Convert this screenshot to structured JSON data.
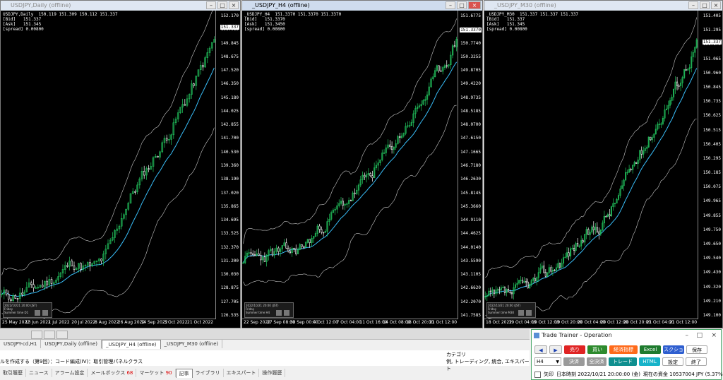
{
  "windows": [
    {
      "title": "USDJPY,Daily (offline)",
      "active": false,
      "info": [
        "USDJPY,Daily  150.119 151.309 150.112 151.337",
        "[Bid]   151.337",
        "[Ask]   151.345",
        "[spread] 0.00800"
      ],
      "price_labels": [
        "152.170",
        "151.015",
        "149.845",
        "148.675",
        "147.520",
        "146.350",
        "145.180",
        "144.025",
        "142.855",
        "141.700",
        "140.530",
        "139.360",
        "138.190",
        "137.020",
        "135.865",
        "134.695",
        "133.525",
        "132.370",
        "131.200",
        "130.030",
        "128.875",
        "127.705",
        "126.535"
      ],
      "current_price": "151.337",
      "time_labels": [
        "25 May 2022",
        "13 Jun 2022",
        "1 Jul 2022",
        "20 Jul 2022",
        "8 Aug 2022",
        "26 Aug 2022",
        "14 Sep 2022",
        "3 Oct 2022",
        "21 Oct 2022"
      ],
      "mini_box": [
        "2022/10/21 20:00 (JST)",
        "Friday",
        "Summer time   D1"
      ]
    },
    {
      "title": "_USDJPY_H4 (offline)",
      "active": true,
      "info": [
        "_USDJPY_H4  151.3370 151.3370 151.3370",
        "[Bid]   151.3370",
        "[Ask]   151.3450",
        "[spread] 0.00800"
      ],
      "price_labels": [
        "151.6775",
        "151.2225",
        "150.7740",
        "150.3255",
        "149.8705",
        "149.4220",
        "148.9735",
        "148.5185",
        "148.0700",
        "147.6150",
        "147.1665",
        "146.7180",
        "146.2630",
        "145.8145",
        "145.3660",
        "144.9110",
        "144.4625",
        "144.0140",
        "143.5590",
        "143.1105",
        "142.6620",
        "142.2070",
        "141.7585"
      ],
      "current_price": "151.3370",
      "time_labels": [
        "22 Sep 2022",
        "27 Sep 08:00",
        "30 Sep 00:00",
        "4 Oct 12:00",
        "7 Oct 04:00",
        "11 Oct 16:00",
        "14 Oct 08:00",
        "18 Oct 20:00",
        "21 Oct 12:00"
      ],
      "mini_box": [
        "2022/10/21 20:00 (JST)",
        "Friday",
        "Summer time   H4"
      ]
    },
    {
      "title": "_USDJPY_M30 (offline)",
      "active": false,
      "info": [
        "_USDJPY_M30  151.337 151.337 151.337",
        "[Bid]   151.337",
        "[Ask]   151.345",
        "[spread] 0.00800"
      ],
      "price_labels": [
        "151.405",
        "151.295",
        "151.175",
        "151.065",
        "150.960",
        "150.845",
        "150.735",
        "150.625",
        "150.515",
        "150.405",
        "150.295",
        "150.185",
        "150.075",
        "149.965",
        "149.855",
        "149.750",
        "149.650",
        "149.540",
        "149.430",
        "149.320",
        "149.210",
        "149.100"
      ],
      "current_price": "151.337",
      "time_labels": [
        "18 Oct 2022",
        "19 Oct 04:00",
        "19 Oct 12:00",
        "19 Oct 20:00",
        "20 Oct 04:00",
        "20 Oct 12:00",
        "20 Oct 20:00",
        "21 Oct 04:00",
        "21 Oct 12:00"
      ],
      "mini_box": [
        "2022/10/21 20:00 (JST)",
        "Friday",
        "Summer time   M30"
      ]
    }
  ],
  "chart_tabs": [
    "USDJPY-cd,H1",
    "USDJPY,Daily (offline)",
    "_USDJPY_H4 (offline)",
    "_USDJPY_M30 (offline)"
  ],
  "news": {
    "text": "ルを作成する（第9回）：コード編成(IV)：取引管理パネルクラス",
    "category_header": "カテゴリ",
    "category_value": "例, トレーディング, 統合, エキスパート"
  },
  "bottom_tabs": [
    {
      "label": "取引履歴",
      "count": ""
    },
    {
      "label": "ニュース",
      "count": ""
    },
    {
      "label": "アラーム設定",
      "count": ""
    },
    {
      "label": "メールボックス",
      "count": "68"
    },
    {
      "label": "マーケット",
      "count": "90"
    },
    {
      "label": "記事",
      "count": ""
    },
    {
      "label": "ライブラリ",
      "count": ""
    },
    {
      "label": "エキスパート",
      "count": ""
    },
    {
      "label": "操作履歴",
      "count": ""
    }
  ],
  "operation": {
    "title": "Trade Trainer - Operation",
    "prev": "◀",
    "next": "▶",
    "timeframe": "H4",
    "sell": "売り",
    "buy": "買い",
    "indicators": "経済指標",
    "excel": "Excel",
    "screenshot": "スクショ",
    "save": "保存",
    "settle": "決済",
    "settle_all": "全決済",
    "trade": "トレード",
    "html": "HTML",
    "settings": "設定",
    "exit": "終了",
    "status_checkbox": "矢印",
    "status_time": "日本時刻 2022/10/21 20:00:00 (金)",
    "status_balance": "現在の資金 10537004 JPY (5.37%)"
  },
  "colors": {
    "bull": "#22c55e",
    "bear": "#ffffff",
    "ma": "#38bdf8",
    "band": "#c8c8c8",
    "sell_btn": "#e02424",
    "buy_btn": "#2e8b2e",
    "indicator_btn": "#ff6a1a",
    "excel_btn": "#1e7b2e",
    "screenshot_btn": "#2f5fd0",
    "trade_btn": "#0f8f8f",
    "html_btn": "#17b3c9"
  }
}
